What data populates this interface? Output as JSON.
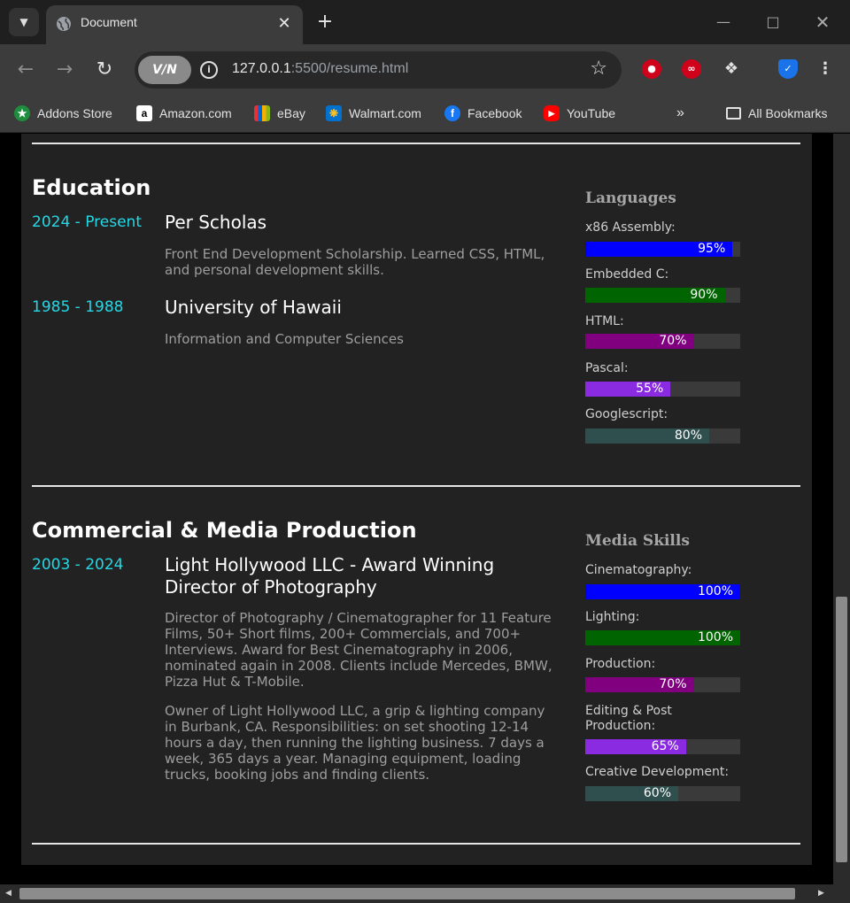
{
  "browser": {
    "tab_title": "Document",
    "url_host": "127.0.0.1",
    "url_rest": ":5500/resume.html",
    "vpn_label": "V/N",
    "bookmarks": [
      {
        "label": "Addons Store",
        "icon": "addons-store-icon",
        "color": "#1e8e3e"
      },
      {
        "label": "Amazon.com",
        "icon": "amazon-icon",
        "color": "#ffffff"
      },
      {
        "label": "eBay",
        "icon": "ebay-icon",
        "color": "#e53238"
      },
      {
        "label": "Walmart.com",
        "icon": "walmart-icon",
        "color": "#0071ce"
      },
      {
        "label": "Facebook",
        "icon": "facebook-icon",
        "color": "#1877f2"
      },
      {
        "label": "YouTube",
        "icon": "youtube-icon",
        "color": "#ff0000"
      }
    ],
    "all_bookmarks": "All Bookmarks"
  },
  "education": {
    "title": "Education",
    "entries": [
      {
        "years": "2024 - Present",
        "title": "Per Scholas",
        "text": "Front End Development Scholarship. Learned CSS, HTML, and personal development skills."
      },
      {
        "years": "1985 - 1988",
        "title": "University of Hawaii",
        "text": "Information and Computer Sciences"
      }
    ]
  },
  "languages": {
    "title": "Languages",
    "skills": [
      {
        "label": "x86 Assembly:",
        "percent": "95%",
        "value": 95,
        "color": "#0000ff"
      },
      {
        "label": "Embedded C:",
        "percent": "90%",
        "value": 90,
        "color": "#006400"
      },
      {
        "label": "HTML:",
        "percent": "70%",
        "value": 70,
        "color": "#800080"
      },
      {
        "label": "Pascal:",
        "percent": "55%",
        "value": 55,
        "color": "#8a2be2"
      },
      {
        "label": "Googlescript:",
        "percent": "80%",
        "value": 80,
        "color": "#2f4f4f"
      }
    ]
  },
  "production": {
    "title": "Commercial & Media Production",
    "entries": [
      {
        "years": "2003 - 2024",
        "title": "Light Hollywood LLC - Award Winning Director of Photography",
        "text1": "Director of Photography / Cinematographer for 11 Feature Films, 50+ Short films, 200+ Commercials, and 700+ Interviews. Award for Best Cinematography in 2006, nominated again in 2008. Clients include Mercedes, BMW, Pizza Hut & T-Mobile.",
        "text2": "Owner of Light Hollywood LLC, a grip & lighting company in Burbank, CA. Responsibilities: on set shooting 12-14 hours a day, then running the lighting business. 7 days a week, 365 days a year. Managing equipment, loading trucks, booking jobs and finding clients."
      }
    ]
  },
  "media": {
    "title": "Media Skills",
    "skills": [
      {
        "label": "Cinematography:",
        "percent": "100%",
        "value": 100,
        "color": "#0000ff"
      },
      {
        "label": "Lighting:",
        "percent": "100%",
        "value": 100,
        "color": "#006400"
      },
      {
        "label": "Production:",
        "percent": "70%",
        "value": 70,
        "color": "#800080"
      },
      {
        "label": "Editing & Post Production:",
        "percent": "65%",
        "value": 65,
        "color": "#8a2be2"
      },
      {
        "label": "Creative Development:",
        "percent": "60%",
        "value": 60,
        "color": "#2f4f4f"
      }
    ]
  }
}
